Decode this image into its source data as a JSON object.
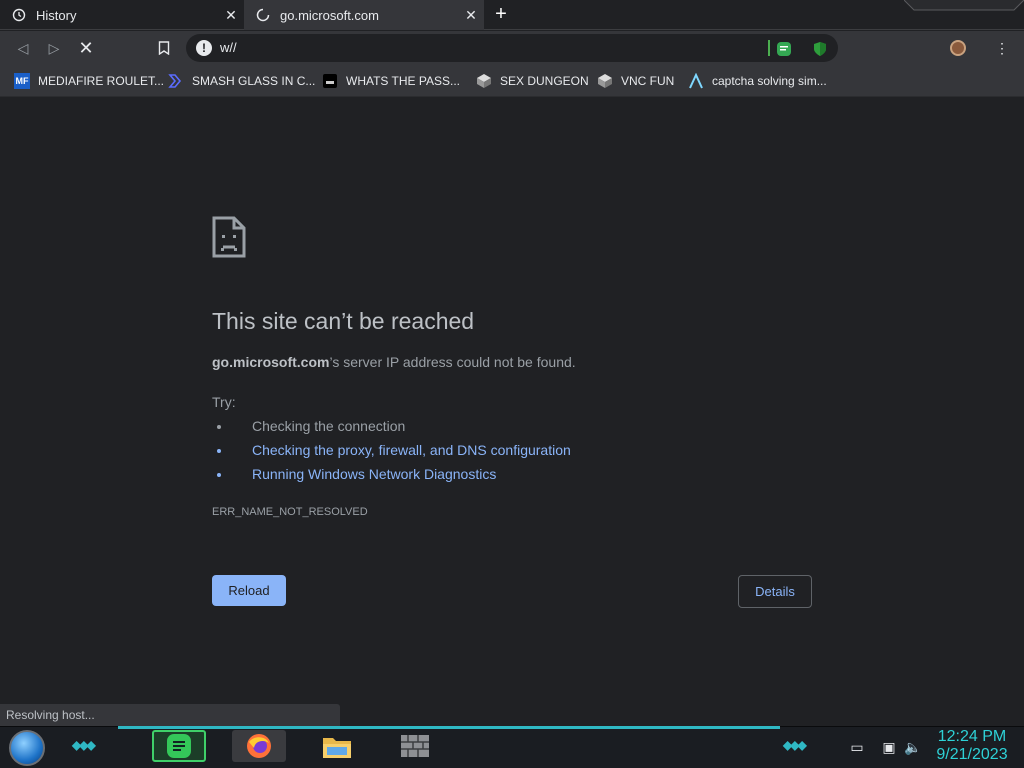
{
  "tabs": [
    {
      "title": "History",
      "icon": "history-icon",
      "active": false
    },
    {
      "title": "go.microsoft.com",
      "icon": "loading-spinner-icon",
      "active": true
    }
  ],
  "omnibox": {
    "url": "w//"
  },
  "bookmarks": [
    {
      "label": "MEDIAFIRE ROULET...",
      "icon": "mediafire-icon",
      "badge": "MF"
    },
    {
      "label": "SMASH GLASS IN C...",
      "icon": "brackets-icon"
    },
    {
      "label": "WHATS THE PASS...",
      "icon": "terminal-icon"
    },
    {
      "label": "SEX DUNGEON",
      "icon": "cube-icon"
    },
    {
      "label": "VNC FUN",
      "icon": "cube-icon"
    },
    {
      "label": "captcha solving sim...",
      "icon": "lambda-icon"
    }
  ],
  "error": {
    "title": "This site can’t be reached",
    "host": "go.microsoft.com",
    "message": "’s server IP address could not be found.",
    "try_label": "Try:",
    "suggestions": [
      "Checking the connection",
      "Checking the proxy, firewall, and DNS configuration",
      "Running Windows Network Diagnostics"
    ],
    "code": "ERR_NAME_NOT_RESOLVED",
    "reload_label": "Reload",
    "details_label": "Details"
  },
  "status": "Resolving host...",
  "clock": {
    "time": "12:24 PM",
    "date": "9/21/2023"
  },
  "colors": {
    "link": "#8ab4f8",
    "accent": "#2fb8c4",
    "clock": "#2ed1d6"
  }
}
